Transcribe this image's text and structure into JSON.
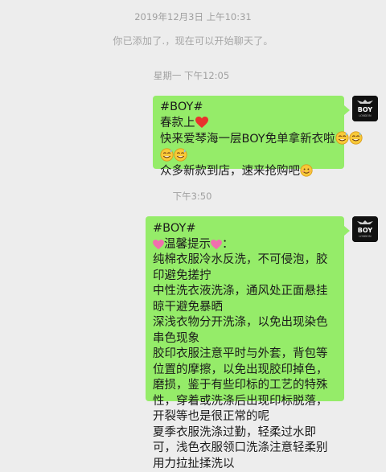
{
  "timestamps": {
    "date_header": "2019年12月3日 上午10:31",
    "mon_noon": "星期一 下午12:05",
    "afternoon": "下午3:50"
  },
  "system_message": "你已添加了.，现在可以开始聊天了。",
  "message1": {
    "lines": [
      "#BOY#",
      "春款上",
      "快来爱琴海一层BOY免单拿新衣啦",
      "",
      "众多新款到店，速来抢购吧"
    ]
  },
  "message2": {
    "lines": [
      "#BOY#",
      "温馨提示",
      "纯棉衣服冷水反洗，不可侵泡，胶印避免搓拧",
      "中性洗衣液洗涤，通风处正面悬挂晾干避免暴晒",
      "深浅衣物分开洗涤，以免出现染色串色现象",
      "胶印衣服注意平时与外套，背包等位置的摩擦，以免出现胶印掉色，磨损，鉴于有些印标的工艺的特殊性，穿着或洗涤后出现印标脱落，开裂等也是很正常的呢",
      "夏季衣服洗涤过勤，轻柔过水即可，浅色衣服领口洗涤注意轻柔别用力拉扯揉洗以"
    ]
  },
  "avatar": {
    "brand": "BOY",
    "sub": "LONDON"
  },
  "colors": {
    "bubble": "#95ec69",
    "background": "#ededed"
  },
  "icons": [
    "heart-emoji",
    "sweat-smile-emoji",
    "smile-emoji",
    "pink-heart-emoji",
    "eagle-logo-icon"
  ]
}
